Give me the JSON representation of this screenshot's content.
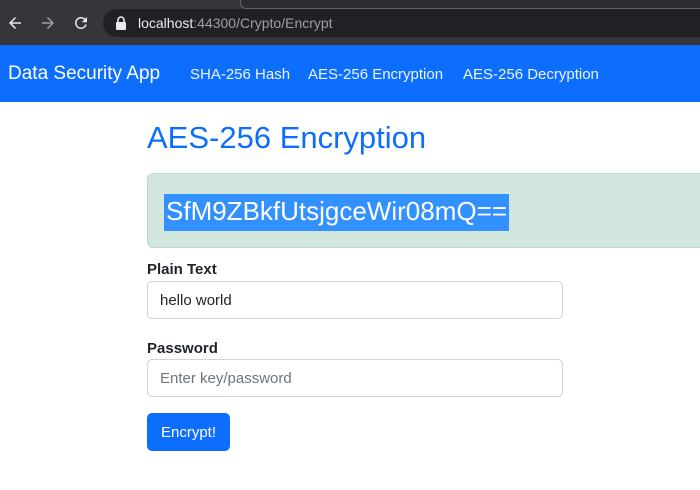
{
  "browser": {
    "url_host": "localhost",
    "url_rest": ":44300/Crypto/Encrypt",
    "icons": [
      "back-arrow-icon",
      "forward-arrow-icon",
      "reload-icon",
      "lock-icon"
    ]
  },
  "navbar": {
    "brand": "Data Security App",
    "links": [
      "SHA-256 Hash",
      "AES-256 Encryption",
      "AES-256 Decryption"
    ],
    "background_color": "#0d6efd"
  },
  "main": {
    "title": "AES-256 Encryption",
    "result": "SfM9ZBkfUtsjgceWir08mQ==",
    "result_box_color": "#d1e7dd",
    "plain_text": {
      "label": "Plain Text",
      "value": "hello world"
    },
    "password": {
      "label": "Password",
      "value": "",
      "placeholder": "Enter key/password"
    },
    "submit_label": "Encrypt!"
  }
}
